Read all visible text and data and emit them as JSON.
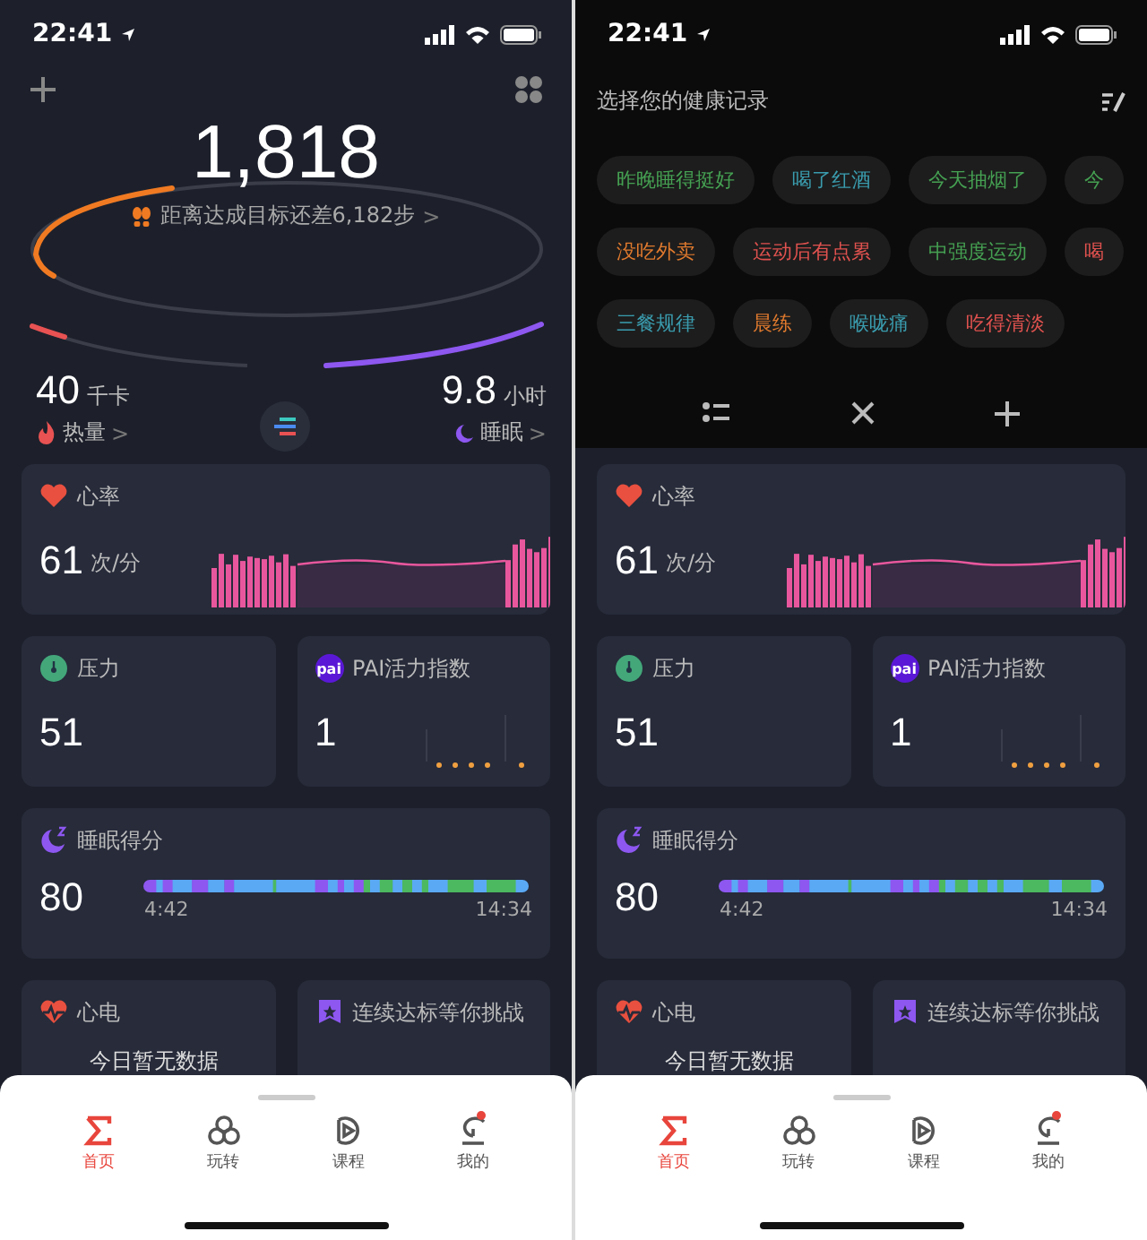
{
  "screens": [
    {
      "kind": "dashboard",
      "status_bar": {
        "time": "22:41"
      },
      "summary": {
        "steps": "1,818",
        "goal_text": "距离达成目标还差6,182步",
        "chevron": ">",
        "calories": {
          "value": "40",
          "unit": "千卡",
          "label": "热量"
        },
        "sleep": {
          "value": "9.8",
          "unit": "小时",
          "label": "睡眠"
        }
      },
      "cards": [
        {
          "kind": "heart",
          "title": "心率",
          "value": "61",
          "unit": "次/分"
        },
        {
          "kind": "stress",
          "title": "压力",
          "value": "51"
        },
        {
          "kind": "pai",
          "title": "PAI活力指数",
          "icon_text": "pai",
          "value": "1"
        },
        {
          "kind": "sleep",
          "title": "睡眠得分",
          "value": "80",
          "start": "4:42",
          "end": "14:34"
        },
        {
          "kind": "ecg",
          "title": "心电",
          "note": "今日暂无数据"
        },
        {
          "kind": "challenge",
          "title": "连续达标等你挑战"
        }
      ],
      "tab_bar": [
        {
          "label": "首页",
          "selected": true,
          "badge": false
        },
        {
          "label": "玩转",
          "selected": false,
          "badge": false
        },
        {
          "label": "课程",
          "selected": false,
          "badge": false
        },
        {
          "label": "我的",
          "selected": false,
          "badge": true
        }
      ]
    },
    {
      "kind": "record_panel",
      "status_bar": {
        "time": "22:41"
      },
      "panel": {
        "title": "选择您的健康记录",
        "tag_rows": [
          [
            {
              "label": "昨晚睡得挺好",
              "color": "#45a052"
            },
            {
              "label": "喝了红酒",
              "color": "#3a9cae"
            },
            {
              "label": "今天抽烟了",
              "color": "#45a052"
            },
            {
              "label": "今",
              "color": "#45a052"
            }
          ],
          [
            {
              "label": "没吃外卖",
              "color": "#e07a2e"
            },
            {
              "label": "运动后有点累",
              "color": "#e0524f"
            },
            {
              "label": "中强度运动",
              "color": "#45a052"
            },
            {
              "label": "喝",
              "color": "#e0524f"
            }
          ],
          [
            {
              "label": "三餐规律",
              "color": "#3a9cae"
            },
            {
              "label": "晨练",
              "color": "#e07a2e"
            },
            {
              "label": "喉咙痛",
              "color": "#3a9cae"
            },
            {
              "label": "吃得清淡",
              "color": "#e0524f"
            }
          ]
        ]
      },
      "cards": [
        {
          "kind": "heart",
          "title": "心率",
          "value": "61",
          "unit": "次/分"
        },
        {
          "kind": "stress",
          "title": "压力",
          "value": "51"
        },
        {
          "kind": "pai",
          "title": "PAI活力指数",
          "icon_text": "pai",
          "value": "1"
        },
        {
          "kind": "sleep",
          "title": "睡眠得分",
          "value": "80",
          "start": "4:42",
          "end": "14:34"
        },
        {
          "kind": "ecg",
          "title": "心电",
          "note": "今日暂无数据"
        },
        {
          "kind": "challenge",
          "title": "连续达标等你挑战"
        }
      ],
      "tab_bar": [
        {
          "label": "首页",
          "selected": true,
          "badge": false
        },
        {
          "label": "玩转",
          "selected": false,
          "badge": false
        },
        {
          "label": "课程",
          "selected": false,
          "badge": false
        },
        {
          "label": "我的",
          "selected": false,
          "badge": true
        }
      ]
    }
  ]
}
